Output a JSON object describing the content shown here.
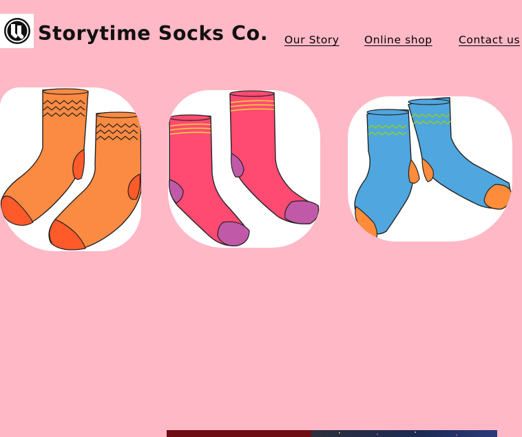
{
  "header": {
    "brand": "Storytime Socks Co.",
    "logo_icon": "sock-pair-logo-icon",
    "nav": [
      {
        "label": "Our Story"
      },
      {
        "label": "Online shop"
      },
      {
        "label": "Contact us"
      }
    ]
  },
  "gallery": {
    "items": [
      {
        "icon": "orange-socks-icon",
        "color": "#fb8a42"
      },
      {
        "icon": "pink-socks-icon",
        "color": "#ff4a72"
      },
      {
        "icon": "blue-socks-icon",
        "color": "#50a6de"
      }
    ]
  },
  "colors": {
    "background": "#ffb8c6",
    "card": "#ffffff",
    "text": "#111111"
  }
}
